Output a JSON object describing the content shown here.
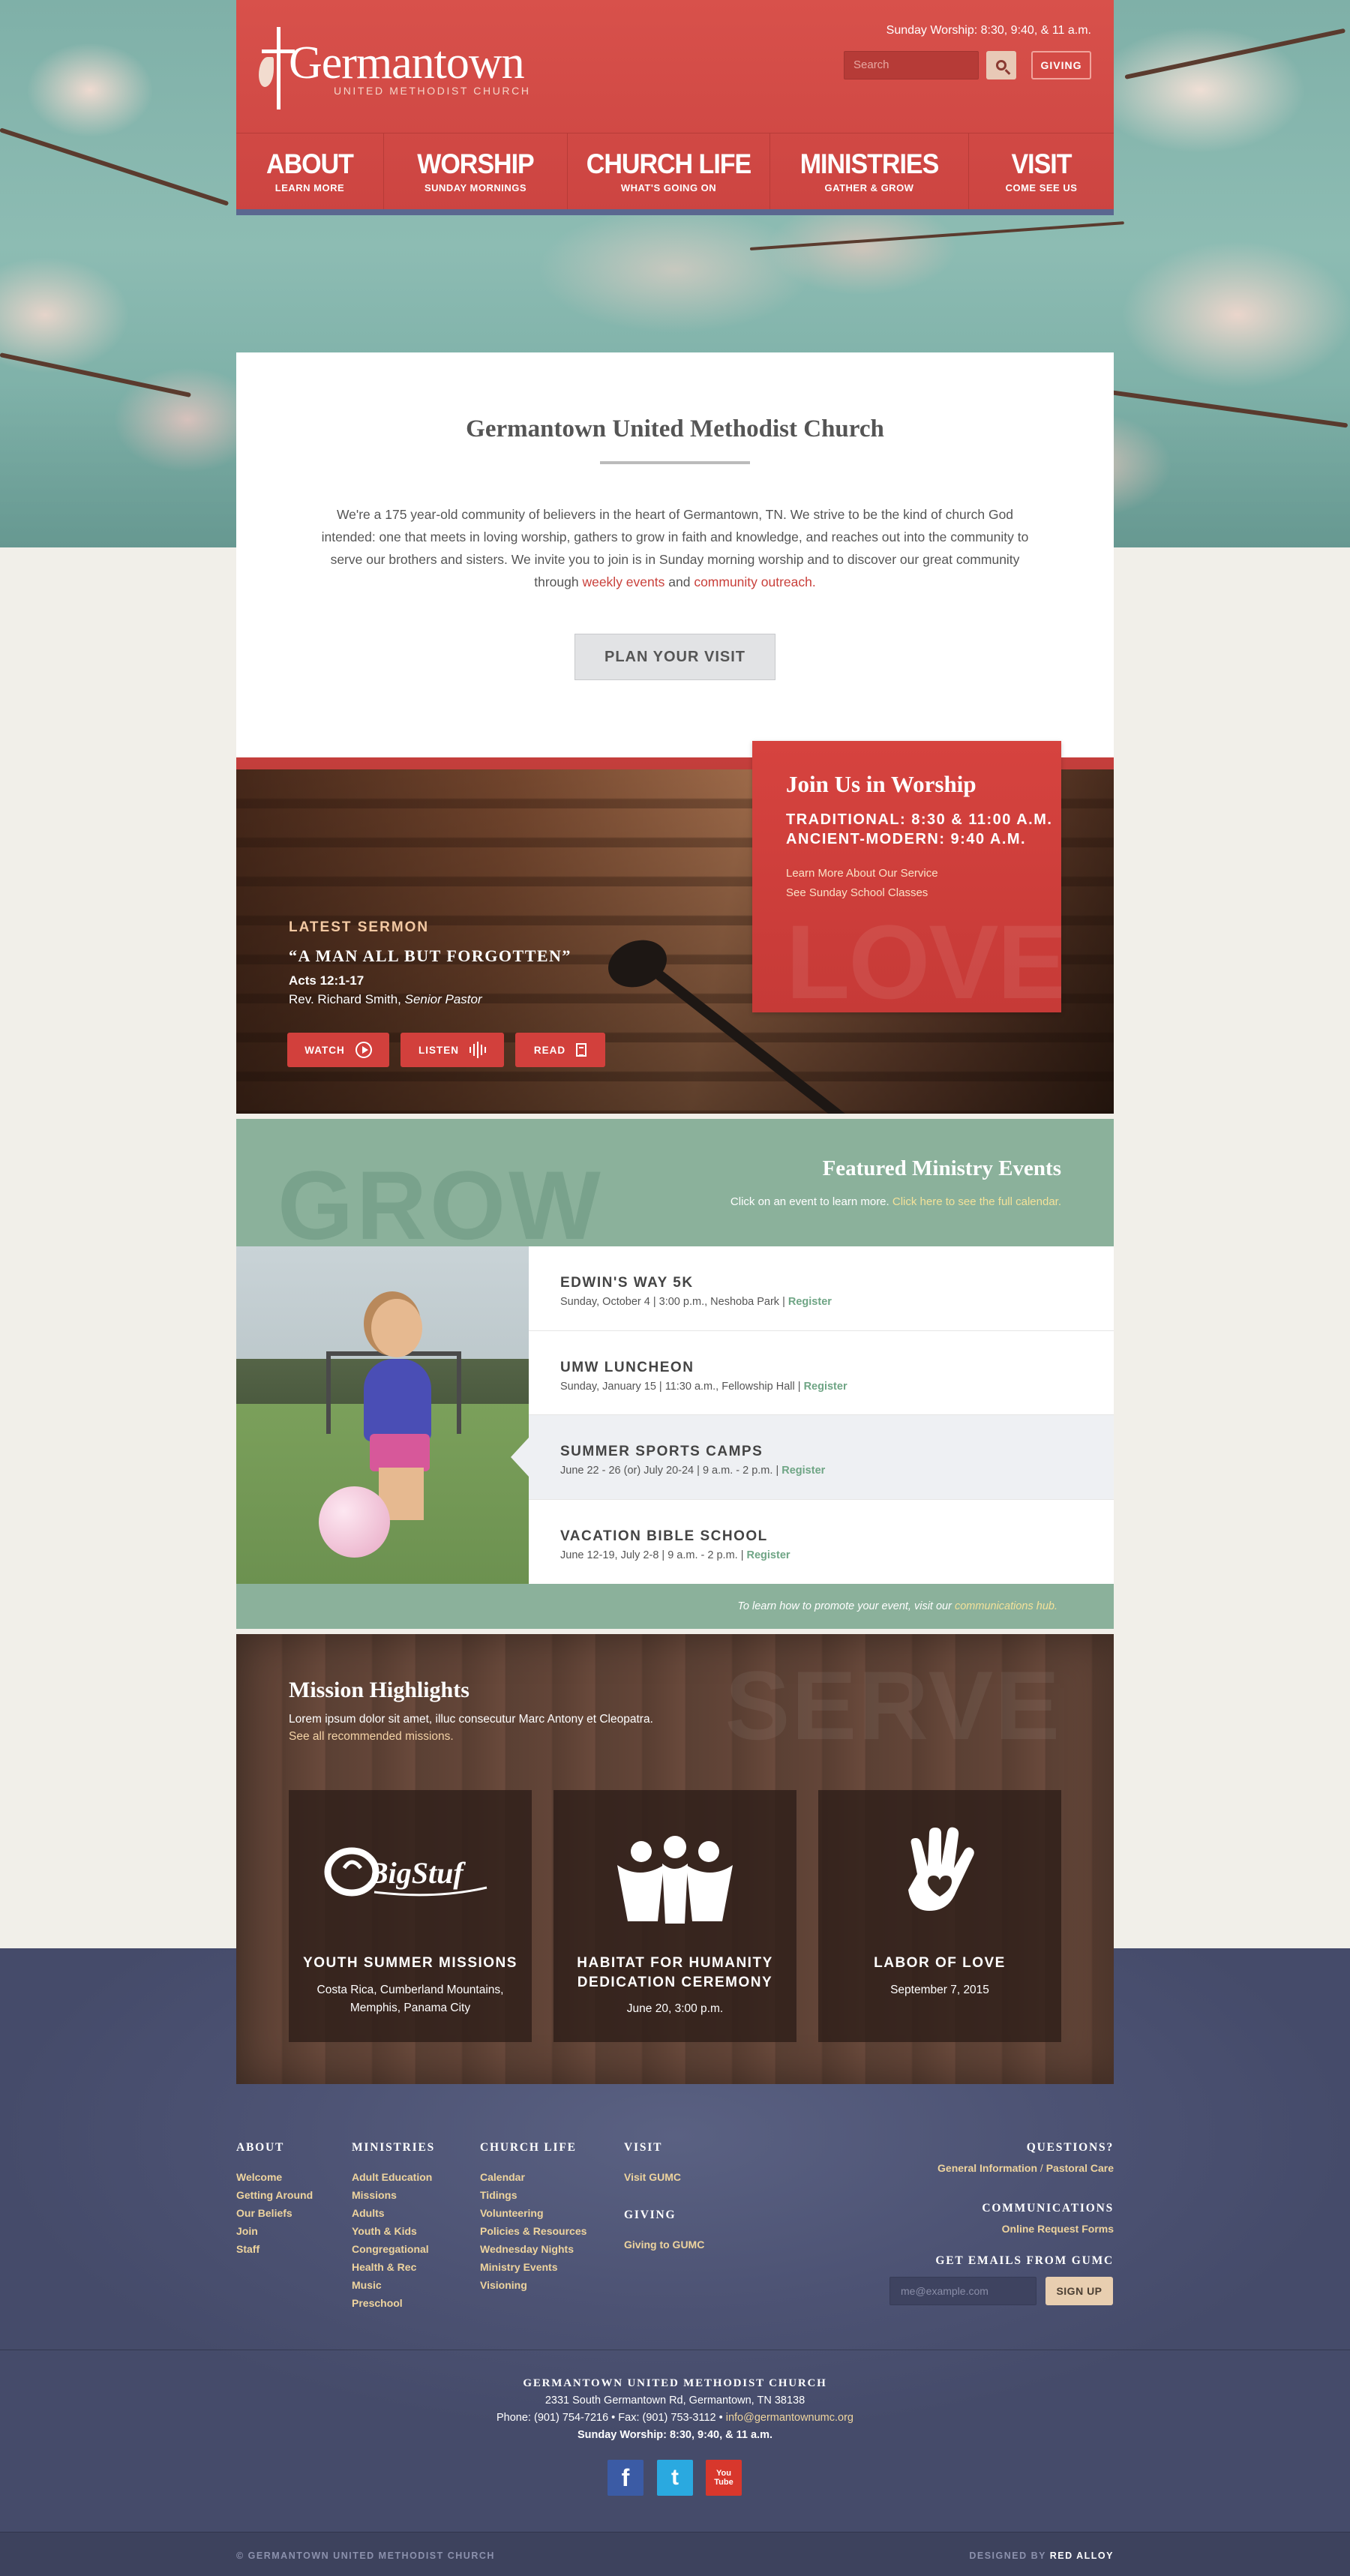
{
  "header": {
    "logo_name": "Germantown",
    "logo_sub": "UNITED METHODIST CHURCH",
    "worship_times": "Sunday Worship: 8:30, 9:40, & 11 a.m.",
    "search_placeholder": "Search",
    "giving_label": "GIVING",
    "nav": [
      {
        "title": "ABOUT",
        "sub": "LEARN MORE"
      },
      {
        "title": "WORSHIP",
        "sub": "SUNDAY MORNINGS"
      },
      {
        "title": "CHURCH LIFE",
        "sub": "WHAT'S GOING ON"
      },
      {
        "title": "MINISTRIES",
        "sub": "GATHER & GROW"
      },
      {
        "title": "VISIT",
        "sub": "COME SEE US"
      }
    ]
  },
  "intro": {
    "title": "Germantown United Methodist Church",
    "text_1": "We're a 175 year-old community of believers in the heart of Germantown, TN. We strive to be the kind of church God intended: one that meets in loving worship, gathers to grow in faith and knowledge, and reaches out into the community to serve our brothers and sisters. We invite you to join is in Sunday morning worship and to discover our great community through ",
    "link_1": "weekly events",
    "and": " and ",
    "link_2": "community outreach.",
    "button": "PLAN YOUR VISIT"
  },
  "sermon": {
    "label": "LATEST SERMON",
    "title": "“A MAN ALL BUT FORGOTTEN”",
    "ref": "Acts 12:1-17",
    "pastor_name": "Rev. Richard Smith, ",
    "pastor_role": "Senior Pastor",
    "watch": "WATCH",
    "listen": "LISTEN",
    "read": "READ"
  },
  "worship_box": {
    "title": "Join Us in Worship",
    "traditional": "TRADITIONAL: 8:30 & 11:00 A.M.",
    "ancient": "ANCIENT-MODERN: 9:40 A.M.",
    "link_1": "Learn More About Our Service",
    "link_2": "See Sunday School Classes",
    "watermark": "LOVE"
  },
  "events": {
    "watermark": "GROW",
    "title": "Featured Ministry Events",
    "sub": "Click on an event to learn more. ",
    "sub_link": "Click here to see the full calendar.",
    "register": "Register",
    "items": [
      {
        "title": "EDWIN'S WAY 5K",
        "meta": "Sunday, October 4  |  3:00 p.m., Neshoba Park  |  "
      },
      {
        "title": "UMW LUNCHEON",
        "meta": "Sunday, January 15  |  11:30 a.m., Fellowship Hall  |  "
      },
      {
        "title": "SUMMER SPORTS CAMPS",
        "meta": "June 22 - 26 (or) July 20-24  |  9 a.m. - 2 p.m.   |  "
      },
      {
        "title": "VACATION BIBLE SCHOOL",
        "meta": "June 12-19, July 2-8  |  9 a.m. - 2 p.m.  |  "
      }
    ],
    "foot": "To learn how to promote your event, visit our ",
    "foot_link": "communications hub."
  },
  "missions": {
    "watermark": "SERVE",
    "title": "Mission Highlights",
    "lead": "Lorem ipsum dolor sit amet, illuc consecutur Marc Antony et Cleopatra.",
    "link": "See all recommended missions.",
    "cards": [
      {
        "title": "YOUTH SUMMER MISSIONS",
        "sub_1": "Costa Rica, Cumberland Mountains,",
        "sub_2": "Memphis, Panama City",
        "logo_text": "BigStuf"
      },
      {
        "title_1": "HABITAT FOR HUMANITY",
        "title_2": "DEDICATION CEREMONY",
        "sub_1": "June 20, 3:00 p.m."
      },
      {
        "title": "LABOR OF LOVE",
        "sub_1": "September 7, 2015"
      }
    ]
  },
  "footer": {
    "about": {
      "head": "ABOUT",
      "links": [
        "Welcome",
        "Getting Around",
        "Our Beliefs",
        "Join",
        "Staff"
      ]
    },
    "ministries": {
      "head": "MINISTRIES",
      "links": [
        "Adult Education",
        "Missions",
        "Adults",
        "Youth & Kids",
        "Congregational",
        "Health & Rec",
        "Music",
        "Preschool"
      ]
    },
    "church_life": {
      "head": "CHURCH LIFE",
      "links": [
        "Calendar",
        "Tidings",
        "Volunteering",
        "Policies & Resources",
        "Wednesday Nights",
        "Ministry Events",
        "Visioning"
      ]
    },
    "visit": {
      "head": "VISIT",
      "links": [
        "Visit GUMC"
      ]
    },
    "giving": {
      "head": "GIVING",
      "links": [
        "Giving to GUMC"
      ]
    },
    "questions": {
      "head": "QUESTIONS?",
      "link_1": "General Information",
      "sep": " / ",
      "link_2": "Pastoral Care"
    },
    "communications": {
      "head": "COMMUNICATIONS",
      "link": "Online Request Forms"
    },
    "emails": {
      "head": "GET EMAILS FROM GUMC",
      "placeholder": "me@example.com",
      "button": "SIGN UP"
    },
    "org": "GERMANTOWN UNITED METHODIST CHURCH",
    "address": "2331 South Germantown Rd, Germantown, TN 38138",
    "contact": "Phone: (901) 754-7216  •  Fax: (901) 753-3112  •  ",
    "email": "info@germantownumc.org",
    "worship": "Sunday Worship: 8:30, 9:40, & 11 a.m.",
    "social": {
      "facebook": "f",
      "twitter": "t",
      "youtube": "You Tube"
    },
    "copyright": "© GERMANTOWN UNITED METHODIST CHURCH",
    "designed_by": "DESIGNED BY ",
    "designer": "RED ALLOY"
  },
  "colors": {
    "brand_red": "#d4463f",
    "green": "#8bb19b",
    "navy": "#4d5374",
    "gold": "#eed49e"
  }
}
